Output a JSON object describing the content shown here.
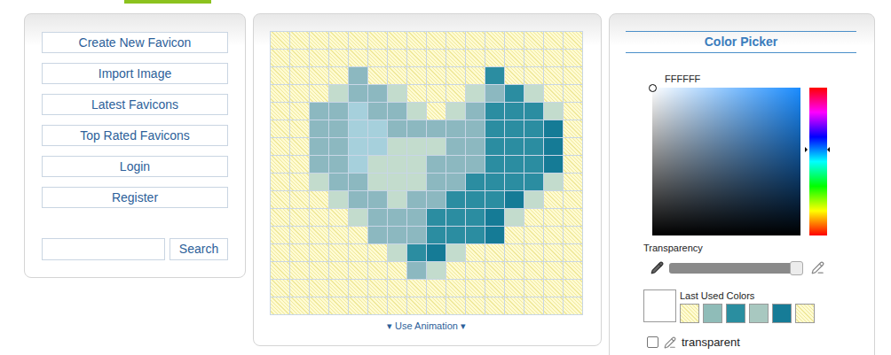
{
  "menu": [
    {
      "label": "Create New Favicon"
    },
    {
      "label": "Import Image"
    },
    {
      "label": "Latest Favicons"
    },
    {
      "label": "Top Rated Favicons"
    },
    {
      "label": "Login"
    },
    {
      "label": "Register"
    }
  ],
  "search": {
    "button": "Search"
  },
  "canvas": {
    "palette": {
      "a": "#8cb8c0",
      "b": "#2b8da1",
      "c": "#157b96",
      "d": "#a6d0dc",
      "e": "#c3dccd"
    },
    "rows": [
      "................",
      "................",
      "....a......b....",
      "...eaae...eabe..",
      "..aadaae.eabbbe.",
      "..aaddaaaaabbbc.",
      "..aaddeeeaabbbc.",
      "..aadeeeaaabbbc.",
      "..eaaeeeaabbbbe.",
      "...eaaeaabbbce..",
      "....eaaabbbce...",
      ".....aaabbbc....",
      "......ebce......",
      ".......ae.......",
      "................",
      "................"
    ]
  },
  "animation": {
    "label": "Use Animation",
    "arrow": "▾"
  },
  "colorPicker": {
    "title": "Color Picker",
    "hex": "FFFFFF",
    "hue": "#1a8cff",
    "hue_level": 0.42,
    "transparency": {
      "label": "Transparency",
      "level": 0.95
    },
    "lastUsed": {
      "label": "Last Used Colors",
      "current": "#ffffff",
      "swatches": [
        {
          "kind": "transparent",
          "color": "#fffbd0"
        },
        {
          "kind": "solid",
          "color": "#8fbcb8"
        },
        {
          "kind": "solid",
          "color": "#2a8ea0"
        },
        {
          "kind": "solid",
          "color": "#a8c8c0"
        },
        {
          "kind": "solid",
          "color": "#167c97"
        },
        {
          "kind": "transparent",
          "color": "#fffbd0"
        }
      ]
    },
    "options": [
      {
        "label": "transparent",
        "checked": false,
        "kind": "transparent"
      },
      {
        "label": "pick existing color",
        "checked": false,
        "kind": "pick"
      }
    ]
  }
}
